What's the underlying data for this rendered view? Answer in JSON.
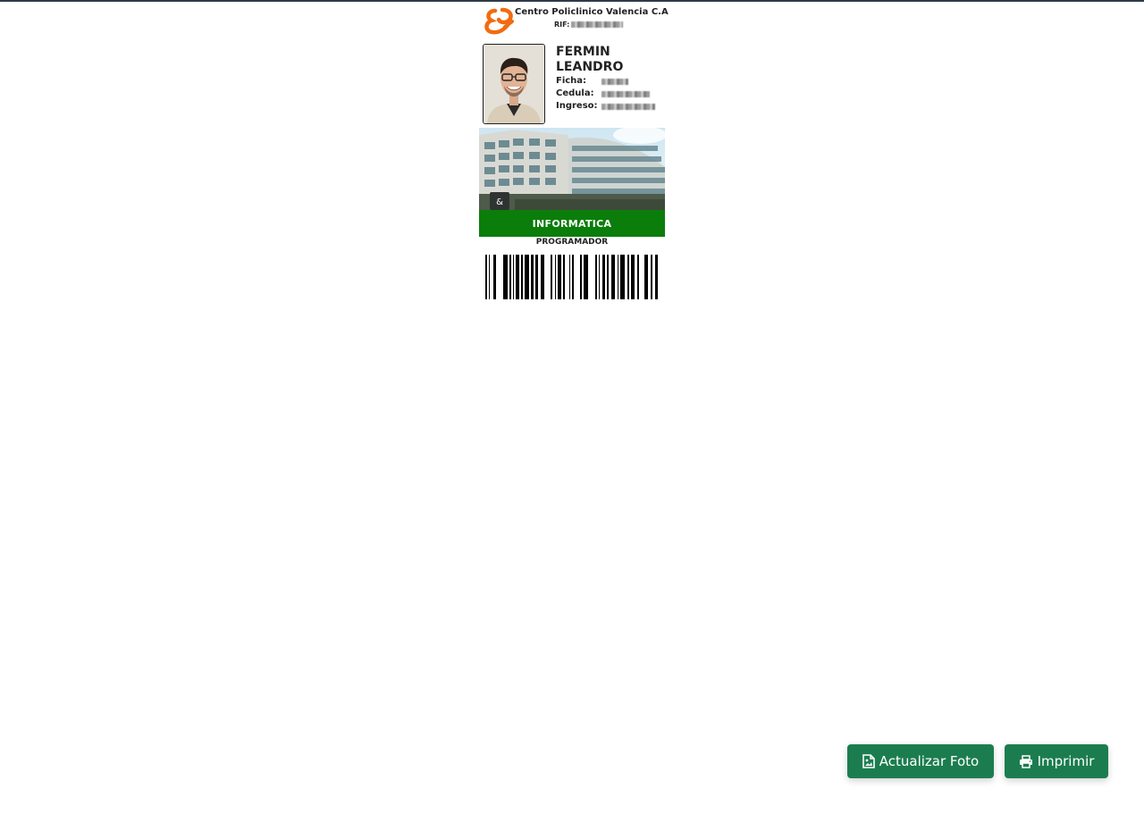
{
  "card": {
    "company": "Centro Policlinico Valencia C.A",
    "rif_label": "RIF:",
    "employee": {
      "first_name": "FERMIN",
      "last_name": "LEANDRO",
      "fields": [
        {
          "label": "Ficha:"
        },
        {
          "label": "Cedula:"
        },
        {
          "label": "Ingreso:"
        }
      ]
    },
    "department": "INFORMATICA",
    "position": "PROGRAMADOR"
  },
  "actions": {
    "update_photo": {
      "label": "Actualizar Foto",
      "icon": "image-file-icon"
    },
    "print": {
      "label": "Imprimir",
      "icon": "printer-icon"
    }
  },
  "colors": {
    "brand_orange": "#f26b0f",
    "department_green": "#0a7d0a",
    "button_green": "#1b7d4f"
  }
}
